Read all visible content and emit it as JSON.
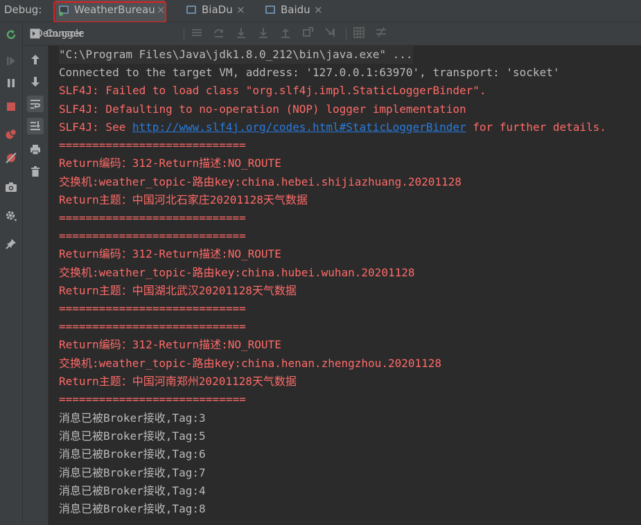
{
  "tabbar": {
    "debug_label": "Debug:",
    "tabs": [
      {
        "label": "WeatherBureau",
        "close": "×"
      },
      {
        "label": "BiaDu",
        "close": "×"
      },
      {
        "label": "Baidu",
        "close": "×"
      }
    ]
  },
  "subtabs": {
    "debugger_label": "Debugger",
    "console_label": "Console"
  },
  "console": {
    "lines": [
      {
        "text": "\"C:\\Program Files\\Java\\jdk1.8.0_212\\bin\\java.exe\" ...",
        "style": "gray"
      },
      {
        "text": "Connected to the target VM, address: '127.0.0.1:63970', transport: 'socket'",
        "style": "gray"
      },
      {
        "text": "SLF4J: Failed to load class \"org.slf4j.impl.StaticLoggerBinder\".",
        "style": "red"
      },
      {
        "text": "SLF4J: Defaulting to no-operation (NOP) logger implementation",
        "style": "red"
      },
      {
        "prefix": "SLF4J: See ",
        "link": "http://www.slf4j.org/codes.html#StaticLoggerBinder",
        "suffix": " for further details.",
        "style": "red"
      },
      {
        "text": "============================",
        "style": "red"
      },
      {
        "text": "Return编码：312-Return描述:NO_ROUTE",
        "style": "red"
      },
      {
        "text": "交换机:weather_topic-路由key:china.hebei.shijiazhuang.20201128",
        "style": "red"
      },
      {
        "text": "Return主题：中国河北石家庄20201128天气数据",
        "style": "red"
      },
      {
        "text": "============================",
        "style": "red"
      },
      {
        "text": "============================",
        "style": "red"
      },
      {
        "text": "Return编码：312-Return描述:NO_ROUTE",
        "style": "red"
      },
      {
        "text": "交换机:weather_topic-路由key:china.hubei.wuhan.20201128",
        "style": "red"
      },
      {
        "text": "Return主题：中国湖北武汉20201128天气数据",
        "style": "red"
      },
      {
        "text": "============================",
        "style": "red"
      },
      {
        "text": "============================",
        "style": "red"
      },
      {
        "text": "Return编码：312-Return描述:NO_ROUTE",
        "style": "red"
      },
      {
        "text": "交换机:weather_topic-路由key:china.henan.zhengzhou.20201128",
        "style": "red"
      },
      {
        "text": "Return主题：中国河南郑州20201128天气数据",
        "style": "red"
      },
      {
        "text": "============================",
        "style": "red"
      },
      {
        "text": "消息已被Broker接收,Tag:3",
        "style": "gray"
      },
      {
        "text": "消息已被Broker接收,Tag:5",
        "style": "gray"
      },
      {
        "text": "消息已被Broker接收,Tag:6",
        "style": "gray"
      },
      {
        "text": "消息已被Broker接收,Tag:7",
        "style": "gray"
      },
      {
        "text": "消息已被Broker接收,Tag:4",
        "style": "gray"
      },
      {
        "text": "消息已被Broker接收,Tag:8",
        "style": "gray"
      }
    ]
  },
  "colors": {
    "background": "#2b2b2b",
    "toolbar": "#3c3f41",
    "error_text": "#ff6b68",
    "normal_text": "#bbbbbb",
    "link": "#287bde",
    "highlight_box": "#e0201f"
  }
}
